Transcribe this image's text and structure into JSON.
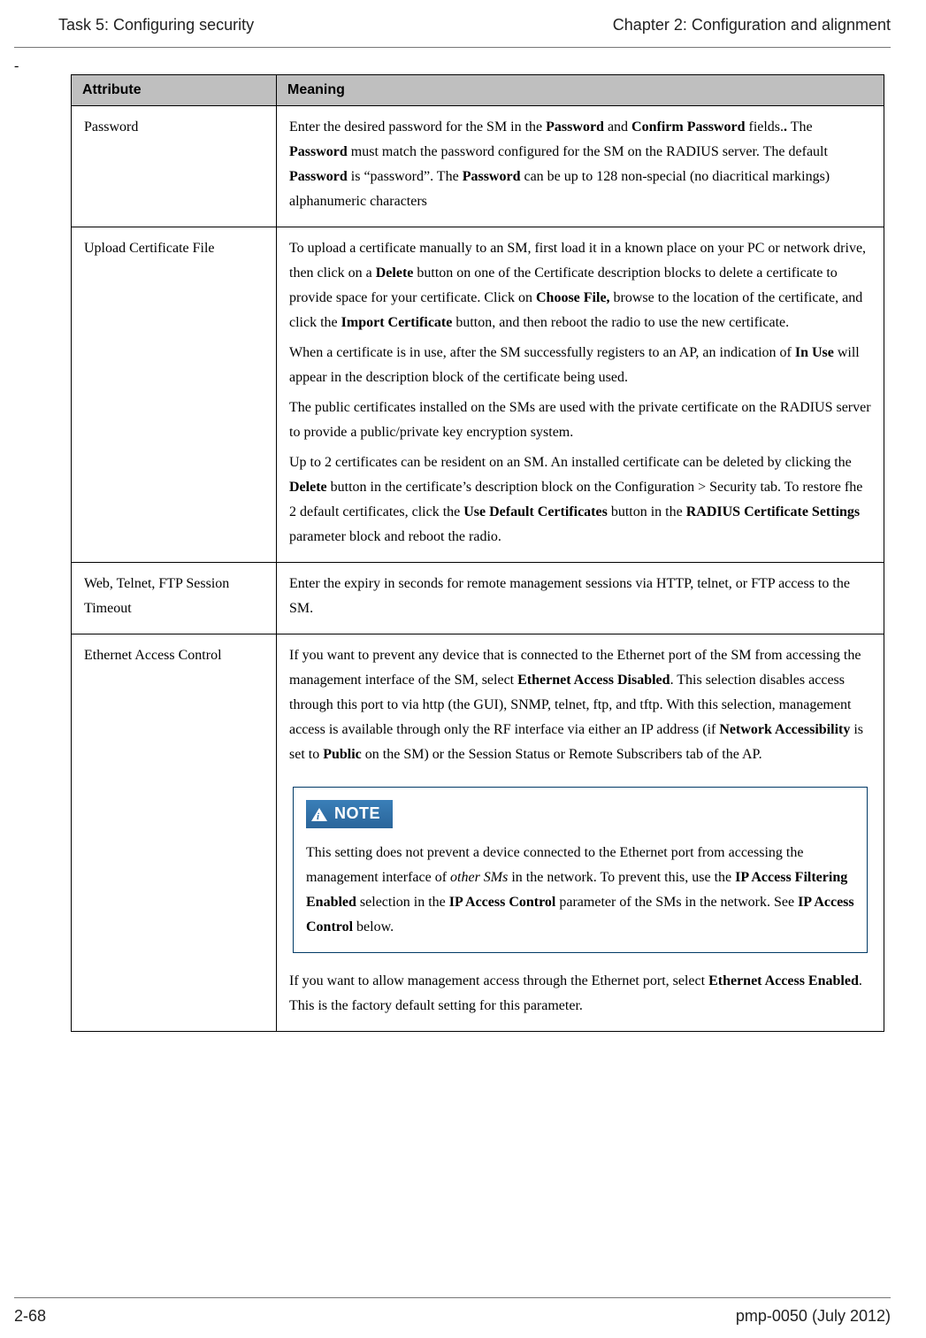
{
  "header": {
    "left": "Task 5: Configuring security",
    "right": "Chapter 2:  Configuration and alignment"
  },
  "dash": "-",
  "table": {
    "headers": {
      "attribute": "Attribute",
      "meaning": "Meaning"
    },
    "rows": {
      "password": {
        "attr": "Password"
      },
      "upload": {
        "attr": "Upload Certificate File"
      },
      "web": {
        "attr": "Web, Telnet, FTP Session Timeout",
        "meaning": "Enter the expiry in seconds for remote management sessions via HTTP, telnet, or FTP access to the SM."
      },
      "eac": {
        "attr": "Ethernet Access Control"
      }
    }
  },
  "pw": {
    "t1": "Enter the desired password for the SM in the ",
    "b1": "Password",
    "t2": " and ",
    "b2": "Confirm Password",
    "t3": " fields.",
    "b3": ".",
    "t4": " The ",
    "b4": "Password",
    "t5": " must match the password configured for the SM on the RADIUS server. The default ",
    "b5": "Password",
    "t6": " is “password”. The ",
    "b6": "Password",
    "t7": " can be up to 128 non-special (no diacritical markings) alphanumeric characters"
  },
  "up": {
    "p1a": "To upload a certificate manually to an SM, first load it in a known place on your PC or network drive, then click on a ",
    "p1b1": "Delete",
    "p1b": " button on one of the Certificate description blocks to delete a certificate to provide space for your certificate. Click on ",
    "p1b2": "Choose File,",
    "p1c": " browse to the location of the certificate, and click the ",
    "p1b3": "Import Certificate",
    "p1d": " button, and then reboot the radio to use the new certificate.",
    "p2a": "When a certificate is in use, after the SM successfully registers to an AP, an indication of ",
    "p2b1": "In Use",
    "p2b": " will appear in the description block of the certificate being used.",
    "p3": "The public certificates installed on the SMs are used with the private certificate on the RADIUS server to provide a public/private key encryption system.",
    "p4a": "Up to 2 certificates can be resident on an SM. An installed certificate can be deleted by clicking the ",
    "p4b1": "Delete",
    "p4b": " button in the certificate’s description block on the Configuration > Security tab. To restore fhe 2 default certificates, click the ",
    "p4b2": "Use Default Certificates",
    "p4c": " button in the ",
    "p4b3": "RADIUS Certificate Settings",
    "p4d": " parameter block and reboot the radio."
  },
  "eac": {
    "p1a": "If you want to prevent any device that is connected to the Ethernet port of the SM from accessing the management interface of the SM, select ",
    "p1b1": "Ethernet Access Disabled",
    "p1b": ". This selection disables access through this port to via http (the GUI), SNMP, telnet, ftp, and tftp. With this selection, management access is available through only the RF interface via either an IP address (if ",
    "p1b2": "Network Accessibility",
    "p1c": " is set to ",
    "p1b3": "Public",
    "p1d": " on the SM) or the Session Status or Remote Subscribers tab of the AP.",
    "note_label": "NOTE",
    "note_a": "This setting does not prevent a device connected to the Ethernet port from accessing the management interface of ",
    "note_i": "other SMs",
    "note_b": " in the network. To prevent this, use the ",
    "note_b1": "IP Access Filtering Enabled",
    "note_c": " selection in the ",
    "note_b2": "IP Access Control",
    "note_d": " parameter of the SMs in the network. See ",
    "note_b3": "IP Access Control",
    "note_e": " below.",
    "p2a": "If you want to allow management access through the Ethernet port, select ",
    "p2b1": "Ethernet Access Enabled",
    "p2b": ". This is the factory default setting for this parameter."
  },
  "footer": {
    "left": "2-68",
    "right": "pmp-0050 (July 2012)"
  }
}
